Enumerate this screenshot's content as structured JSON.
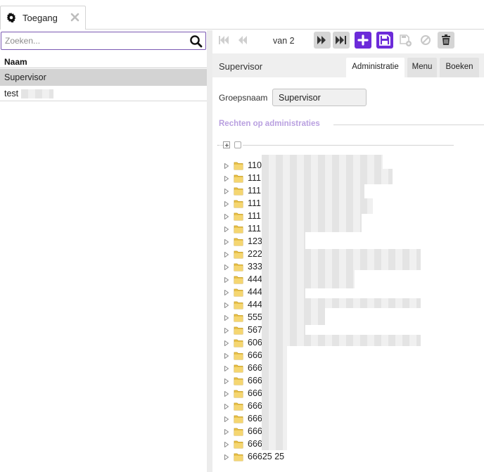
{
  "tab": {
    "label": "Toegang"
  },
  "search": {
    "placeholder": "Zoeken..."
  },
  "list": {
    "column_header": "Naam",
    "rows": [
      {
        "label": "Supervisor",
        "selected": true
      },
      {
        "label": "test",
        "selected": false
      }
    ]
  },
  "toolbar": {
    "page_info": "van 2"
  },
  "detail": {
    "title": "Supervisor",
    "tabs": [
      "Administratie",
      "Menu",
      "Boeken"
    ],
    "group_label": "Groepsnaam",
    "group_value": "Supervisor",
    "section_title": "Rechten op administraties"
  },
  "tree": [
    "110",
    "111",
    "111",
    "111",
    "111",
    "111",
    "123",
    "222",
    "333",
    "444",
    "444",
    "444",
    "555",
    "567",
    "606",
    "666",
    "666",
    "666",
    "666",
    "666",
    "666",
    "666",
    "666",
    "66625 25"
  ],
  "colors": {
    "accent": "#6c2bd9",
    "selected_row": "#d3d3d3",
    "section_title": "#b9a0e0"
  }
}
